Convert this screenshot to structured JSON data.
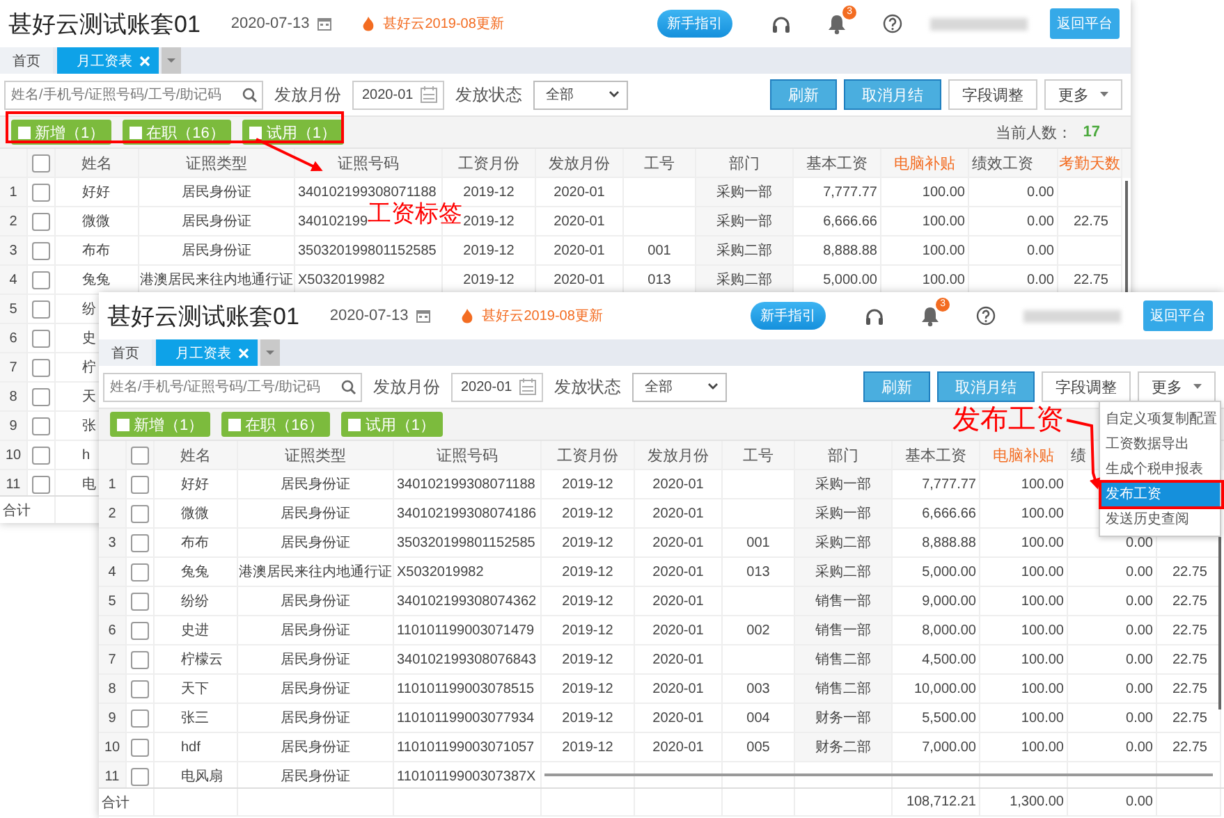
{
  "windows": [
    {
      "title": "甚好云测试账套01",
      "date": "2020-07-13",
      "update": "甚好云2019-08更新",
      "guide_button": "新手指引",
      "notification_count": "3",
      "return_button": "返回平台",
      "tabs": [
        {
          "label": "首页",
          "selected": false,
          "closable": false
        },
        {
          "label": "月工资表",
          "selected": true,
          "closable": true
        }
      ],
      "search": {
        "placeholder": "姓名/手机号/证照号码/工号/助记码"
      },
      "month_label": "发放月份",
      "month_value": "2020-01",
      "status_label": "发放状态",
      "status_value": "全部",
      "buttons": [
        {
          "label": "刷新",
          "kind": "primary"
        },
        {
          "label": "取消月结",
          "kind": "primary"
        },
        {
          "label": "字段调整",
          "kind": "plain"
        },
        {
          "label": "更多",
          "kind": "dropdown"
        }
      ],
      "tags": [
        {
          "label": "新增（1）",
          "checked": false
        },
        {
          "label": "在职（16）",
          "checked": false
        },
        {
          "label": "试用（1）",
          "checked": false
        }
      ],
      "headcount_label": "当前人数：",
      "headcount_value": "17",
      "columns": [
        {
          "label": "姓名",
          "highlight": false
        },
        {
          "label": "证照类型",
          "highlight": false
        },
        {
          "label": "证照号码",
          "highlight": false
        },
        {
          "label": "工资月份",
          "highlight": false
        },
        {
          "label": "发放月份",
          "highlight": false
        },
        {
          "label": "工号",
          "highlight": false
        },
        {
          "label": "部门",
          "highlight": false
        },
        {
          "label": "基本工资",
          "highlight": false
        },
        {
          "label": "电脑补贴",
          "highlight": true
        },
        {
          "label": "绩效工资",
          "highlight": false
        },
        {
          "label": "考勤天数",
          "highlight": true
        }
      ],
      "rows": [
        {
          "index": "1",
          "checked": false,
          "name": "好好",
          "id_type": "居民身份证",
          "id_no": "340102199308071188",
          "pay_month": "2019-12",
          "issue_month": "2020-01",
          "dept": "采购一部",
          "base": "7,777.77",
          "pc": "100.00",
          "perf": "0.00"
        },
        {
          "index": "2",
          "checked": false,
          "name": "微微",
          "id_type": "居民身份证",
          "id_no": "340102199",
          "pay_month": "2019-12",
          "issue_month": "2020-01",
          "dept": "采购一部",
          "base": "6,666.66",
          "pc": "100.00",
          "perf": "0.00",
          "days": "22.75"
        },
        {
          "index": "3",
          "checked": false,
          "name": "布布",
          "id_type": "居民身份证",
          "id_no": "350320199801152585",
          "pay_month": "2019-12",
          "issue_month": "2020-01",
          "emp_no": "001",
          "dept": "采购二部",
          "base": "8,888.88",
          "pc": "100.00",
          "perf": "0.00"
        },
        {
          "index": "4",
          "checked": false,
          "name": "兔兔",
          "id_type": "港澳居民来往内地通行证",
          "id_no": "X5032019982",
          "pay_month": "2019-12",
          "issue_month": "2020-01",
          "emp_no": "013",
          "dept": "采购二部",
          "base": "5,000.00",
          "pc": "100.00",
          "perf": "0.00",
          "days": "22.75"
        },
        {
          "index": "5",
          "checked": false,
          "name": "纷"
        },
        {
          "index": "6",
          "checked": false,
          "name": "史"
        },
        {
          "index": "7",
          "checked": false,
          "name": "柠"
        },
        {
          "index": "8",
          "checked": false,
          "name": "天"
        },
        {
          "index": "9",
          "checked": false,
          "name": "张"
        },
        {
          "index": "10",
          "checked": false,
          "name": "h"
        },
        {
          "index": "11",
          "checked": false,
          "name": "电"
        }
      ],
      "total_label": "合计",
      "select_all_checked": false
    },
    {
      "title": "甚好云测试账套01",
      "date": "2020-07-13",
      "update": "甚好云2019-08更新",
      "guide_button": "新手指引",
      "notification_count": "3",
      "return_button": "返回平台",
      "tabs": [
        {
          "label": "首页",
          "selected": false,
          "closable": false
        },
        {
          "label": "月工资表",
          "selected": true,
          "closable": true
        }
      ],
      "search": {
        "placeholder": "姓名/手机号/证照号码/工号/助记码"
      },
      "month_label": "发放月份",
      "month_value": "2020-01",
      "status_label": "发放状态",
      "status_value": "全部",
      "buttons": [
        {
          "label": "刷新",
          "kind": "primary"
        },
        {
          "label": "取消月结",
          "kind": "primary"
        },
        {
          "label": "字段调整",
          "kind": "plain"
        },
        {
          "label": "更多",
          "kind": "dropdown"
        }
      ],
      "tags": [
        {
          "label": "新增（1）",
          "checked": false
        },
        {
          "label": "在职（16）",
          "checked": false
        },
        {
          "label": "试用（1）",
          "checked": false
        }
      ],
      "columns": [
        {
          "label": "姓名",
          "highlight": false
        },
        {
          "label": "证照类型",
          "highlight": false
        },
        {
          "label": "证照号码",
          "highlight": false
        },
        {
          "label": "工资月份",
          "highlight": false
        },
        {
          "label": "发放月份",
          "highlight": false
        },
        {
          "label": "工号",
          "highlight": false
        },
        {
          "label": "部门",
          "highlight": false
        },
        {
          "label": "基本工资",
          "highlight": false
        },
        {
          "label": "电脑补贴",
          "highlight": true
        },
        {
          "label": "绩",
          "highlight": false
        }
      ],
      "rows": [
        {
          "index": "1",
          "checked": false,
          "name": "好好",
          "id_type": "居民身份证",
          "id_no": "340102199308071188",
          "pay_month": "2019-12",
          "issue_month": "2020-01",
          "dept": "采购一部",
          "base": "7,777.77",
          "pc": "100.00"
        },
        {
          "index": "2",
          "checked": false,
          "name": "微微",
          "id_type": "居民身份证",
          "id_no": "340102199308074186",
          "pay_month": "2019-12",
          "issue_month": "2020-01",
          "dept": "采购一部",
          "base": "6,666.66",
          "pc": "100.00"
        },
        {
          "index": "3",
          "checked": false,
          "name": "布布",
          "id_type": "居民身份证",
          "id_no": "350320199801152585",
          "pay_month": "2019-12",
          "issue_month": "2020-01",
          "emp_no": "001",
          "dept": "采购二部",
          "base": "8,888.88",
          "pc": "100.00",
          "perf": "0.00"
        },
        {
          "index": "4",
          "checked": false,
          "name": "兔兔",
          "id_type": "港澳居民来往内地通行证",
          "id_no": "X5032019982",
          "pay_month": "2019-12",
          "issue_month": "2020-01",
          "emp_no": "013",
          "dept": "采购二部",
          "base": "5,000.00",
          "pc": "100.00",
          "perf": "0.00",
          "days": "22.75"
        },
        {
          "index": "5",
          "checked": false,
          "name": "纷纷",
          "id_type": "居民身份证",
          "id_no": "340102199308074362",
          "pay_month": "2019-12",
          "issue_month": "2020-01",
          "dept": "销售一部",
          "base": "9,000.00",
          "pc": "100.00",
          "perf": "0.00",
          "days": "22.75"
        },
        {
          "index": "6",
          "checked": false,
          "name": "史进",
          "id_type": "居民身份证",
          "id_no": "110101199003071479",
          "pay_month": "2019-12",
          "issue_month": "2020-01",
          "emp_no": "002",
          "dept": "销售一部",
          "base": "8,000.00",
          "pc": "100.00",
          "perf": "0.00",
          "days": "22.75"
        },
        {
          "index": "7",
          "checked": false,
          "name": "柠檬云",
          "id_type": "居民身份证",
          "id_no": "340102199308076843",
          "pay_month": "2019-12",
          "issue_month": "2020-01",
          "dept": "销售二部",
          "base": "4,500.00",
          "pc": "100.00",
          "perf": "0.00",
          "days": "22.75"
        },
        {
          "index": "8",
          "checked": false,
          "name": "天下",
          "id_type": "居民身份证",
          "id_no": "110101199003078515",
          "pay_month": "2019-12",
          "issue_month": "2020-01",
          "emp_no": "003",
          "dept": "销售二部",
          "base": "10,000.00",
          "pc": "100.00",
          "perf": "0.00",
          "days": "22.75"
        },
        {
          "index": "9",
          "checked": false,
          "name": "张三",
          "id_type": "居民身份证",
          "id_no": "110101199003077934",
          "pay_month": "2019-12",
          "issue_month": "2020-01",
          "emp_no": "004",
          "dept": "财务一部",
          "base": "5,500.00",
          "pc": "100.00",
          "perf": "0.00",
          "days": "22.75"
        },
        {
          "index": "10",
          "checked": false,
          "name": "hdf",
          "id_type": "居民身份证",
          "id_no": "110101199003071057",
          "pay_month": "2019-12",
          "issue_month": "2020-01",
          "emp_no": "005",
          "dept": "财务二部",
          "base": "7,000.00",
          "pc": "100.00",
          "perf": "0.00",
          "days": "22.75"
        },
        {
          "index": "11",
          "checked": false,
          "name": "电风扇",
          "id_type": "居民身份证",
          "id_no": "11010119900307387X"
        }
      ],
      "total_label": "合计",
      "select_all_checked": false,
      "totals": {
        "base": "108,712.21",
        "pc": "1,300.00",
        "perf": "0.00"
      },
      "menu": [
        {
          "label": "自定义项复制配置",
          "selected": false
        },
        {
          "label": "工资数据导出",
          "selected": false
        },
        {
          "label": "生成个税申报表",
          "selected": false
        },
        {
          "label": "发布工资",
          "selected": true
        },
        {
          "label": "发送历史查阅",
          "selected": false
        }
      ]
    }
  ],
  "annotations": [
    {
      "label": "工资标签"
    },
    {
      "label": "发布工资"
    }
  ]
}
